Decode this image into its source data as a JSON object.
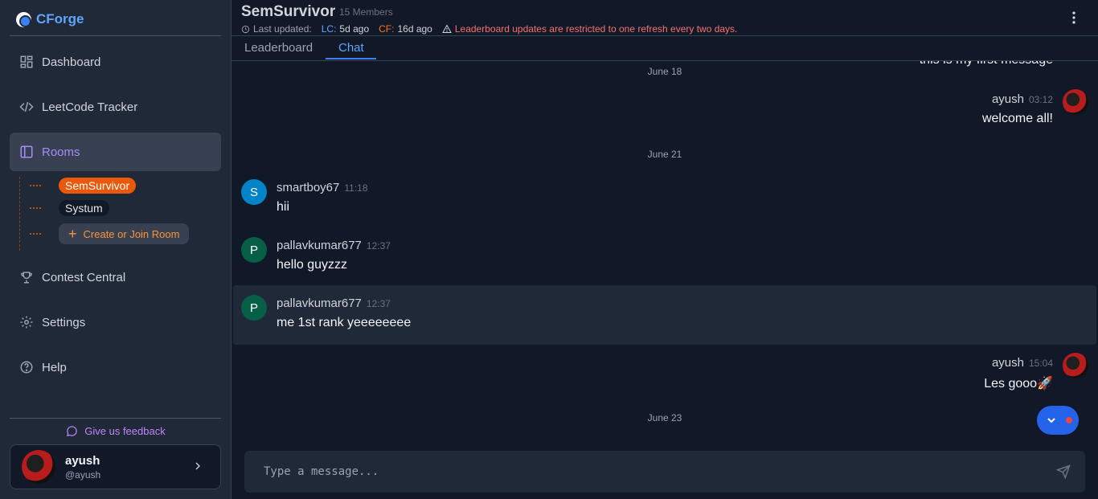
{
  "app": {
    "name": "CForge"
  },
  "sidebar": {
    "nav": [
      {
        "label": "Dashboard",
        "icon": "dashboard-icon"
      },
      {
        "label": "LeetCode Tracker",
        "icon": "code-icon"
      },
      {
        "label": "Rooms",
        "icon": "sidebar-panel-icon",
        "active": true
      },
      {
        "label": "Contest Central",
        "icon": "trophy-icon"
      },
      {
        "label": "Settings",
        "icon": "gear-icon"
      },
      {
        "label": "Help",
        "icon": "help-circle-icon"
      }
    ],
    "rooms": [
      {
        "label": "SemSurvivor",
        "active": true
      },
      {
        "label": "Systum",
        "active": false
      }
    ],
    "create_room_label": "Create or Join Room",
    "feedback_label": "Give us feedback",
    "user": {
      "name": "ayush",
      "handle": "@ayush"
    }
  },
  "header": {
    "room_title": "SemSurvivor",
    "members": "15 Members",
    "last_updated_label": "Last updated:",
    "lc_label": "LC:",
    "lc_value": "5d ago",
    "cf_label": "CF:",
    "cf_value": "16d ago",
    "warning": "Leaderboard updates are restricted to one refresh every two days."
  },
  "tabs": [
    {
      "label": "Leaderboard",
      "active": false
    },
    {
      "label": "Chat",
      "active": true
    }
  ],
  "chat": {
    "partial_top_message": "this is my first message",
    "dates": [
      "June 18",
      "June 21",
      "June 23"
    ],
    "messages": [
      {
        "author": "ayush",
        "time": "03:12",
        "text": "welcome all!",
        "side": "right"
      },
      {
        "author": "smartboy67",
        "initial": "S",
        "time": "11:18",
        "text": "hii",
        "side": "left",
        "avatar_color": "#0284c7"
      },
      {
        "author": "pallavkumar677",
        "initial": "P",
        "time": "12:37",
        "text": "hello guyzzz",
        "side": "left",
        "avatar_color": "#065f46"
      },
      {
        "author": "pallavkumar677",
        "initial": "P",
        "time": "12:37",
        "text": "me 1st rank yeeeeeeee",
        "side": "left",
        "avatar_color": "#065f46"
      },
      {
        "author": "ayush",
        "time": "15:04",
        "text": "Les gooo🚀",
        "side": "right"
      }
    ]
  },
  "composer": {
    "placeholder": "Type a message..."
  },
  "colors": {
    "accent_blue": "#3b82f6",
    "accent_orange": "#ea580c",
    "accent_purple": "#a78bfa",
    "warning_red": "#f87171"
  }
}
